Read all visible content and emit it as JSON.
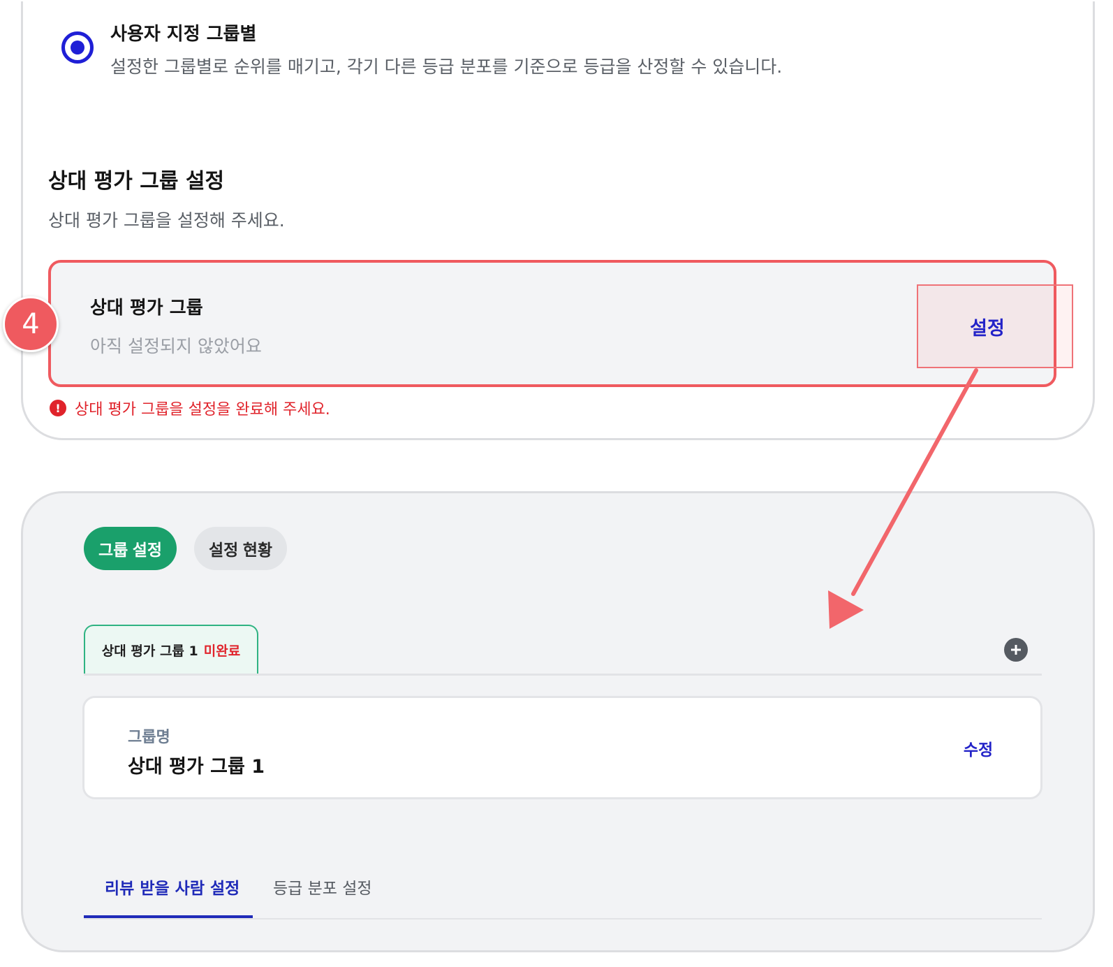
{
  "option": {
    "title": "사용자 지정 그룹별",
    "description": "설정한 그룹별로 순위를 매기고, 각기 다른 등급 분포를 기준으로 등급을 산정할 수 있습니다.",
    "selected": true
  },
  "section": {
    "title": "상대 평가 그룹 설정",
    "description": "상대 평가 그룹을 설정해 주세요."
  },
  "group_card": {
    "title": "상대 평가 그룹",
    "status": "아직 설정되지 않았어요",
    "set_label": "설정"
  },
  "error": {
    "icon": "!",
    "message": "상대 평가 그룹을 설정을 완료해 주세요."
  },
  "step_badge": "4",
  "panel": {
    "pills": [
      {
        "label": "그룹 설정",
        "active": true
      },
      {
        "label": "설정 현황",
        "active": false
      }
    ],
    "group_tab": {
      "name": "상대 평가 그룹 1",
      "status": "미완료"
    },
    "name_card": {
      "label": "그룹명",
      "value": "상대 평가 그룹 1",
      "edit_label": "수정"
    },
    "sub_tabs": [
      {
        "label": "리뷰 받을 사람 설정",
        "active": true
      },
      {
        "label": "등급 분포 설정",
        "active": false
      }
    ]
  },
  "colors": {
    "accent_blue": "#2323c8",
    "radio_blue": "#1f1fd6",
    "highlight_red": "#ef5a5f",
    "error_red": "#e0232b",
    "active_green": "#1aa06b"
  }
}
